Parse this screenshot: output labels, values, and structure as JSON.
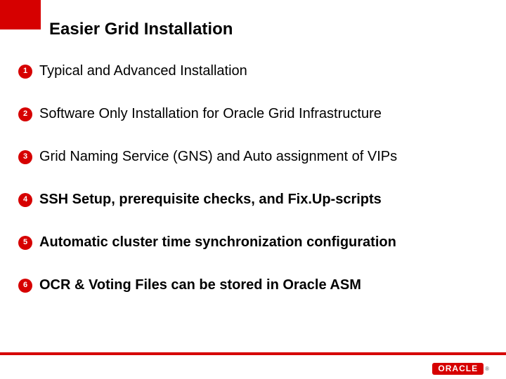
{
  "title": "Easier Grid Installation",
  "brand": {
    "color": "#d60000",
    "logo_text": "ORACLE",
    "logo_mark": "®"
  },
  "items": [
    {
      "num": "1",
      "text": "Typical and Advanced Installation",
      "bold": false
    },
    {
      "num": "2",
      "text": "Software Only Installation for Oracle Grid Infrastructure",
      "bold": false
    },
    {
      "num": "3",
      "text": "Grid Naming Service (GNS) and Auto assignment of VIPs",
      "bold": false
    },
    {
      "num": "4",
      "text": "SSH Setup, prerequisite checks, and Fix.Up-scripts",
      "bold": true
    },
    {
      "num": "5",
      "text": "Automatic cluster time synchronization configuration",
      "bold": true
    },
    {
      "num": "6",
      "text": "OCR & Voting Files can be stored in Oracle ASM",
      "bold": true
    }
  ]
}
